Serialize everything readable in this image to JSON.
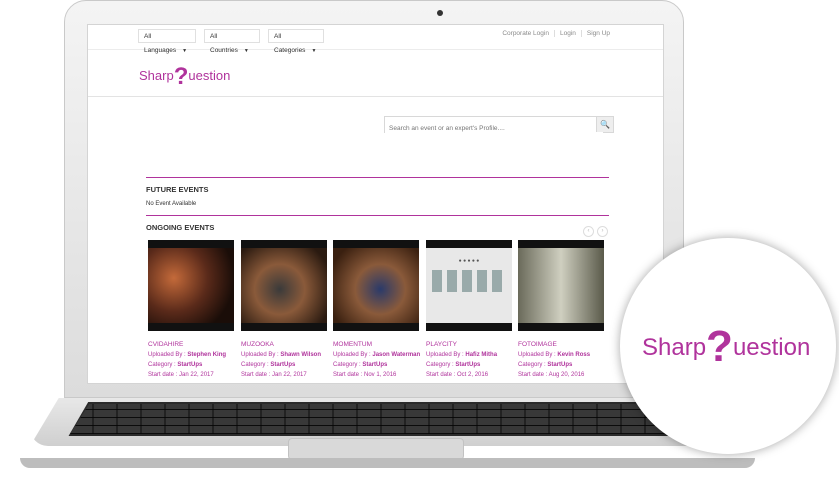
{
  "filters": {
    "languages": "All Languages",
    "countries": "All Countries",
    "categories": "All Categories"
  },
  "top_links": {
    "corporate_login": "Corporate Login",
    "login": "Login",
    "sign_up": "Sign Up"
  },
  "logo": {
    "left": "Sharp",
    "q": "?",
    "right": "uestion"
  },
  "search": {
    "placeholder": "Search an event or an expert's Profile...."
  },
  "future_events": {
    "title": "FUTURE EVENTS",
    "note": "No Event Available"
  },
  "ongoing_events": {
    "title": "ONGOING EVENTS"
  },
  "events": [
    {
      "title": "CVIDAHIRE",
      "uploaded_label": "Uploaded By :",
      "uploader": "Stephen King",
      "category_label": "Category :",
      "category": "StartUps",
      "start": "Start date : Jan 22, 2017"
    },
    {
      "title": "MUZOOKA",
      "uploaded_label": "Uploaded By :",
      "uploader": "Shawn Wilson",
      "category_label": "Category :",
      "category": "StartUps",
      "start": "Start date : Jan 22, 2017"
    },
    {
      "title": "MOMENTUM",
      "uploaded_label": "Uploaded By :",
      "uploader": "Jason Waterman",
      "category_label": "Category :",
      "category": "StartUps",
      "start": "Start date : Nov 1, 2016"
    },
    {
      "title": "PLAYCITY",
      "uploaded_label": "Uploaded By :",
      "uploader": "Hafiz Mitha",
      "category_label": "Category :",
      "category": "StartUps",
      "start": "Start date : Oct 2, 2016"
    },
    {
      "title": "FOTOIMAGE",
      "uploaded_label": "Uploaded By :",
      "uploader": "Kevin Ross",
      "category_label": "Category :",
      "category": "StartUps",
      "start": "Start date : Aug 20, 2016"
    }
  ],
  "colors": {
    "brand": "#b0339c"
  }
}
